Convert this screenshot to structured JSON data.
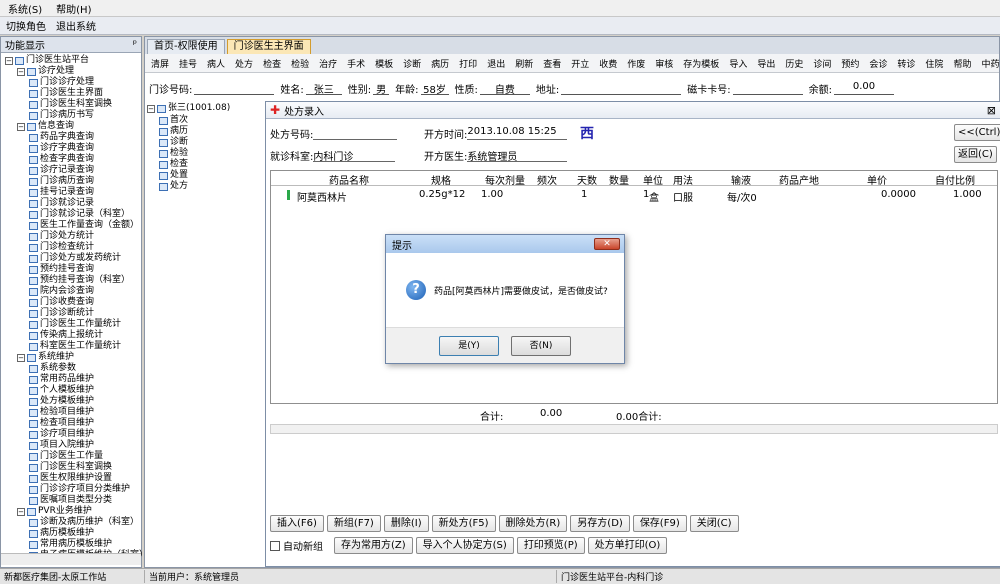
{
  "menubar": [
    "系统(S)",
    "帮助(H)"
  ],
  "toolbar1": [
    "切换角色",
    "退出系统"
  ],
  "leftpanel": {
    "title": "功能显示",
    "pin": "ᵖ",
    "tree": [
      {
        "label": "门诊医生站平台",
        "level": 0,
        "box": "−"
      },
      {
        "label": "诊疗处理",
        "level": 1,
        "box": "−"
      },
      {
        "label": "门诊诊疗处理",
        "level": 2
      },
      {
        "label": "门诊医生主界面",
        "level": 2
      },
      {
        "label": "门诊医生科室调换",
        "level": 2
      },
      {
        "label": "门诊病历书写",
        "level": 2
      },
      {
        "label": "信息查询",
        "level": 1,
        "box": "−"
      },
      {
        "label": "药品字典查询",
        "level": 2
      },
      {
        "label": "诊疗字典查询",
        "level": 2
      },
      {
        "label": "检查字典查询",
        "level": 2
      },
      {
        "label": "诊疗记录查询",
        "level": 2
      },
      {
        "label": "门诊病历查询",
        "level": 2
      },
      {
        "label": "挂号记录查询",
        "level": 2
      },
      {
        "label": "门诊就诊记录",
        "level": 2
      },
      {
        "label": "门诊就诊记录（科室）",
        "level": 2
      },
      {
        "label": "医生工作量查询（金额）",
        "level": 2
      },
      {
        "label": "门诊处方统计",
        "level": 2
      },
      {
        "label": "门诊检查统计",
        "level": 2
      },
      {
        "label": "门诊处方或发药统计",
        "level": 2
      },
      {
        "label": "预约挂号查询",
        "level": 2
      },
      {
        "label": "预约挂号查询（科室）",
        "level": 2
      },
      {
        "label": "院内会诊查询",
        "level": 2
      },
      {
        "label": "门诊收费查询",
        "level": 2
      },
      {
        "label": "门诊诊断统计",
        "level": 2
      },
      {
        "label": "门诊医生工作量统计",
        "level": 2
      },
      {
        "label": "传染病上报统计",
        "level": 2
      },
      {
        "label": "科室医生工作量统计",
        "level": 2
      },
      {
        "label": "系统维护",
        "level": 1,
        "box": "−"
      },
      {
        "label": "系统参数",
        "level": 2
      },
      {
        "label": "常用药品维护",
        "level": 2
      },
      {
        "label": "个人模板维护",
        "level": 2
      },
      {
        "label": "处方模板维护",
        "level": 2
      },
      {
        "label": "检验项目维护",
        "level": 2
      },
      {
        "label": "检查项目维护",
        "level": 2
      },
      {
        "label": "诊疗项目维护",
        "level": 2
      },
      {
        "label": "项目入院维护",
        "level": 2
      },
      {
        "label": "门诊医生工作量",
        "level": 2
      },
      {
        "label": "门诊医生科室调换",
        "level": 2
      },
      {
        "label": "医生权限维护设置",
        "level": 2
      },
      {
        "label": "门诊诊疗项目分类维护",
        "level": 2
      },
      {
        "label": "医嘱项目类型分类",
        "level": 2
      },
      {
        "label": "PVR业务维护",
        "level": 1,
        "box": "−"
      },
      {
        "label": "诊断及病历维护（科室）",
        "level": 2
      },
      {
        "label": "病历模板维护",
        "level": 2
      },
      {
        "label": "常用病历模板维护",
        "level": 2
      },
      {
        "label": "电子病历模板维护（科室）",
        "level": 2
      }
    ]
  },
  "workarea": {
    "tabs": [
      "首页-权限使用",
      "门诊医生主界面"
    ],
    "toolbar": [
      "清屏",
      "挂号",
      "病人",
      "处方",
      "检查",
      "检验",
      "治疗",
      "手术",
      "模板",
      "诊断",
      "病历",
      "打印",
      "退出",
      "刷新",
      "查看",
      "开立",
      "收费",
      "作废",
      "审核",
      "存为模板",
      "导入",
      "导出",
      "历史",
      "诊间",
      "预约",
      "会诊",
      "转诊",
      "住院",
      "帮助",
      "中药HER病历"
    ],
    "patient": {
      "clinic_no_label": "门诊号码:",
      "clinic_no": "",
      "name_label": "姓名:",
      "name": "张三",
      "gender_label": "性别:",
      "gender": "男",
      "age_label": "年龄:",
      "age": "58岁",
      "type_label": "性质:",
      "type": "自费",
      "addr_label": "地址:",
      "addr": "",
      "card_label": "磁卡卡号:",
      "card": "",
      "balance_label": "余额:",
      "balance": "0.00"
    },
    "ptree": {
      "root": "张三(1001.08)",
      "items": [
        "首次",
        "病历",
        "诊断",
        "检验",
        "检查",
        "处置",
        "处方"
      ]
    }
  },
  "prescription": {
    "title": "处方录入",
    "no_label": "处方号码:",
    "no": "",
    "time_label": "开方时间:",
    "time": "2013.10.08 15:25",
    "type_tag": "西",
    "nav_btn": "<<(Ctrl)",
    "dept_label": "就诊科室:",
    "dept": "内科门诊",
    "doctor_label": "开方医生:",
    "doctor": "系统管理员",
    "back_btn": "返回(C)",
    "columns": [
      "药品名称",
      "规格",
      "每次剂量",
      "频次",
      "天数",
      "数量",
      "单位",
      "用法",
      "输液",
      "药品产地",
      "单价",
      "自付比例"
    ],
    "rows": [
      {
        "name": "阿莫西林片",
        "spec": "0.25g*12",
        "dose": "1.00",
        "freq": "",
        "days": "1",
        "qty": "1",
        "unit": "盒",
        "usage": "口服",
        "iv": "每/次0",
        "origin": "",
        "price": "0.0000",
        "ratio": "1.000"
      }
    ],
    "sum_label": "合计:",
    "sum_value": "0.00",
    "sum_total": "0.00合计:",
    "buttons1": [
      "插入(F6)",
      "新组(F7)",
      "删除(I)",
      "新处方(F5)",
      "删除处方(R)",
      "另存方(D)",
      "保存(F9)",
      "关闭(C)"
    ],
    "auto_new": "自动新组",
    "buttons2": [
      "存为常用方(Z)",
      "导入个人协定方(S)",
      "打印预览(P)",
      "处方单打印(O)"
    ]
  },
  "dialog": {
    "title": "提示",
    "close": "✕",
    "message": "药品[阿莫西林片]需要做皮试，是否做皮试?",
    "yes": "是(Y)",
    "no": "否(N)"
  },
  "status": {
    "left": "新都医疗集团-太原工作站",
    "user": "当前用户：系统管理员",
    "site": "门诊医生站平台-内科门诊"
  }
}
